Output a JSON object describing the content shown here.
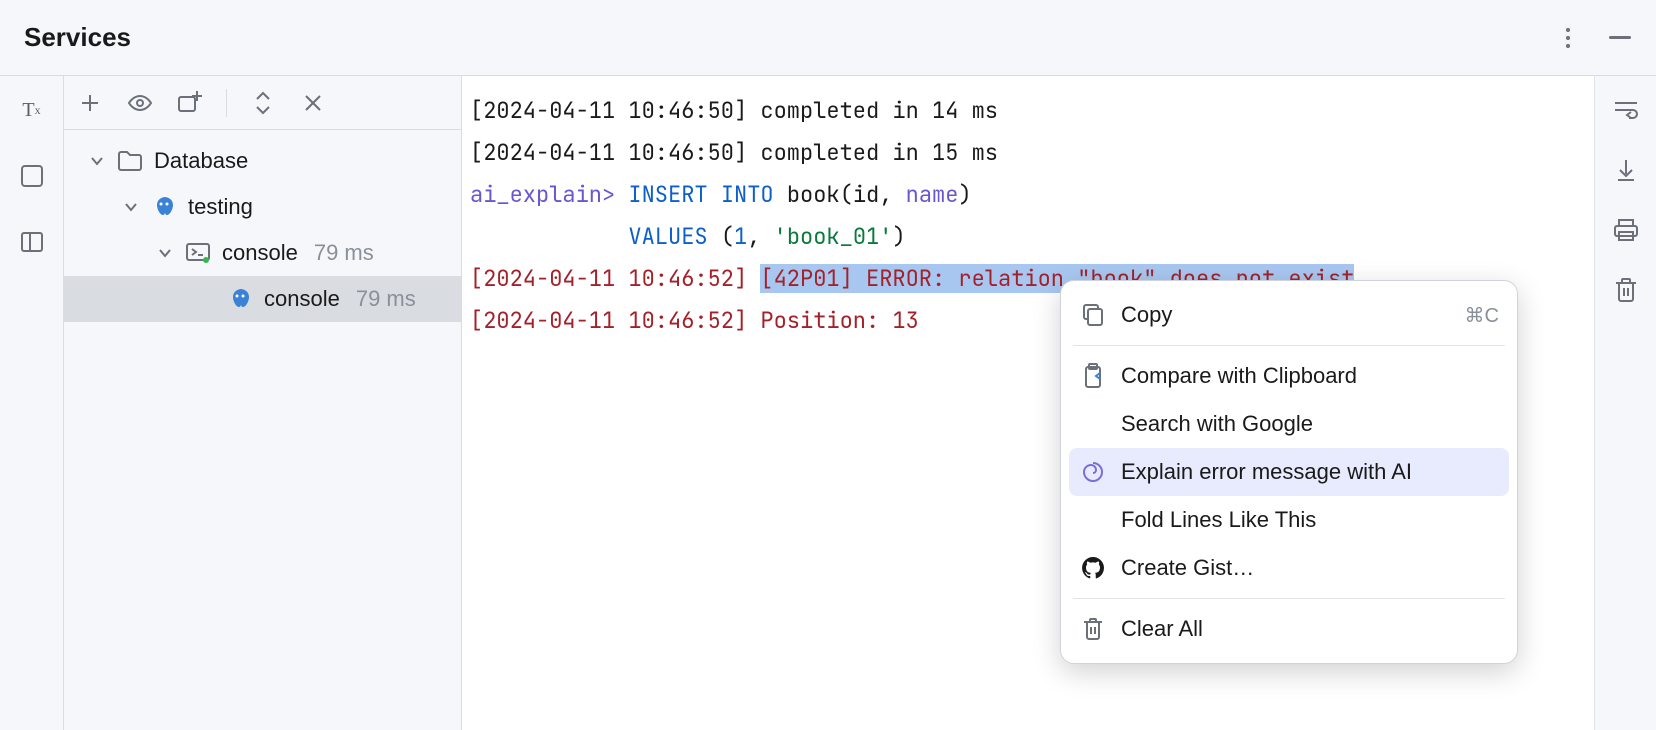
{
  "header": {
    "title": "Services"
  },
  "tree": {
    "root": "Database",
    "node1": "testing",
    "node2": "console",
    "node2_time": "79 ms",
    "node3": "console",
    "node3_time": "79 ms"
  },
  "console": {
    "line1_ts": "[2024-04-11 10:46:50]",
    "line1_msg": "completed in 14 ms",
    "line2_ts": "[2024-04-11 10:46:50]",
    "line2_msg": "completed in 15 ms",
    "prompt": "ai_explain>",
    "sql_kw1": "INSERT",
    "sql_kw2": "INTO",
    "sql_tbl": "book(id,",
    "sql_col": "name",
    "sql_paren": ")",
    "sql_kw3": "VALUES",
    "sql_paren2": " (",
    "sql_val1": "1",
    "sql_comma": ", ",
    "sql_val2": "'book_01'",
    "sql_close": ")",
    "err_ts": "[2024-04-11 10:46:52]",
    "err_msg": "[42P01] ERROR: relation \"book\" does not exist",
    "pos_ts": "[2024-04-11 10:46:52]",
    "pos_msg": "Position: 13"
  },
  "menu": {
    "copy": "Copy",
    "copy_shortcut": "⌘C",
    "compare": "Compare with Clipboard",
    "search": "Search with Google",
    "ai": "Explain error message with AI",
    "fold": "Fold Lines Like This",
    "gist": "Create Gist…",
    "clear": "Clear All"
  }
}
